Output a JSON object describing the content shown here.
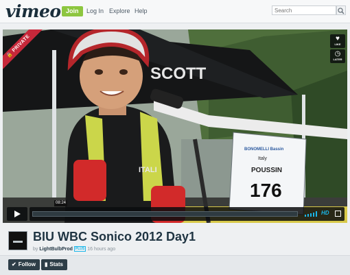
{
  "header": {
    "logo": "vimeo",
    "join_label": "Join",
    "login_label": "Log In",
    "explore_label": "Explore",
    "help_label": "Help",
    "search_placeholder": "Search"
  },
  "video": {
    "private_label": "PRIVATE",
    "like_label": "LIKE",
    "later_label": "LATER",
    "tent_brand": "SCOTT",
    "plate_line1": "BONOMELLI Bassin",
    "plate_line2": "Italy",
    "plate_line3": "POUSSIN",
    "plate_number": "176",
    "shirt_text": "ITALI",
    "time": "08:24",
    "progress": 0.0,
    "hd_label": "HD"
  },
  "info": {
    "title": "BIU WBC Sonico 2012 Day1",
    "by": "by",
    "user": "LightBulbProd",
    "badge": "PLUS",
    "time_ago": "16 hours ago"
  },
  "actions": {
    "follow_label": "Follow",
    "stats_label": "Stats"
  },
  "colors": {
    "accent": "#1ab7ea",
    "join": "#8dc63f",
    "private": "#c6283a",
    "dark": "#1f3442"
  }
}
